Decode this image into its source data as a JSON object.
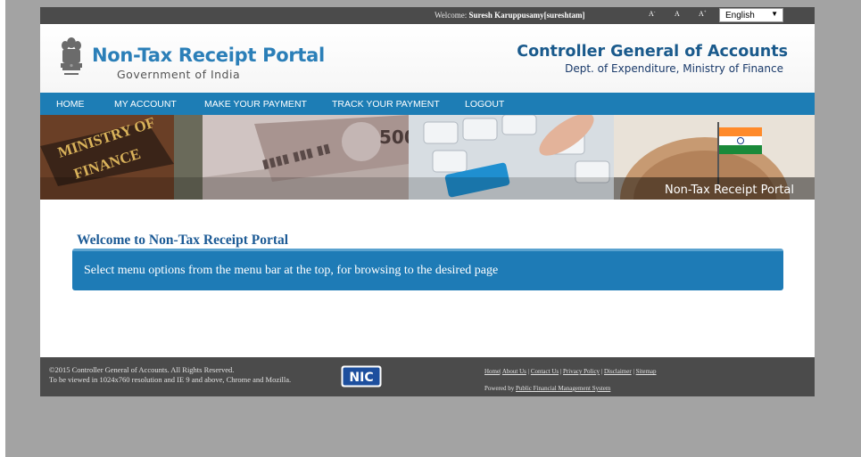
{
  "topbar": {
    "welcome_prefix": "Welcome: ",
    "welcome_user": "Suresh Karuppusamy[sureshtam]",
    "font_decrease": "A-",
    "font_normal": "A",
    "font_increase": "A+",
    "language": "English"
  },
  "header": {
    "portal_title": "Non-Tax Receipt Portal",
    "portal_subtitle": "Government of India",
    "org_title": "Controller General of Accounts",
    "org_subtitle": "Dept. of Expenditure, Ministry of Finance"
  },
  "nav": {
    "items": [
      "HOME",
      "MY ACCOUNT",
      "MAKE YOUR PAYMENT",
      "TRACK YOUR PAYMENT",
      "LOGOUT"
    ]
  },
  "banner": {
    "caption": "Non-Tax Receipt Portal"
  },
  "content": {
    "title": "Welcome to Non-Tax Receipt Portal",
    "message": "Select menu options from the menu bar at the top, for browsing to the desired page"
  },
  "footer": {
    "copyright": "©2015 Controller General of Accounts. All Rights Reserved.",
    "resolution_note": "To be viewed in 1024x760 resolution and IE 9 and above, Chrome and Mozilla.",
    "nic_logo_text": "NIC",
    "links": [
      "Home",
      "About Us",
      "Contact Us",
      "Privacy Policy",
      "Disclaimer",
      "Sitemap"
    ],
    "powered_prefix": "Powered by ",
    "powered_link": "Public Financial Management System"
  },
  "colors": {
    "nav_blue": "#1d7db5",
    "title_blue": "#2b7fb8",
    "dark_bar": "#4b4b4b",
    "outer_gray": "#a3a3a3"
  }
}
